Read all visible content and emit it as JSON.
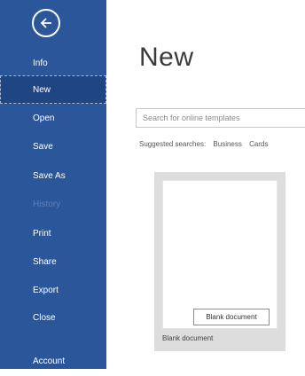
{
  "sidebar": {
    "back_icon": "back-arrow-icon",
    "items": [
      {
        "label": "Info"
      },
      {
        "label": "New"
      },
      {
        "label": "Open"
      },
      {
        "label": "Save"
      },
      {
        "label": "Save As"
      },
      {
        "label": "History"
      },
      {
        "label": "Print"
      },
      {
        "label": "Share"
      },
      {
        "label": "Export"
      },
      {
        "label": "Close"
      },
      {
        "label": "Account"
      }
    ],
    "selected": "New",
    "colors": {
      "background": "#2b579a",
      "selected": "#1f4682"
    }
  },
  "main": {
    "title": "New",
    "search": {
      "placeholder": "Search for online templates",
      "value": ""
    },
    "suggested": {
      "label": "Suggested searches:",
      "items": [
        "Business",
        "Cards"
      ]
    },
    "template": {
      "name": "Blank document",
      "tooltip": "Blank document"
    }
  }
}
